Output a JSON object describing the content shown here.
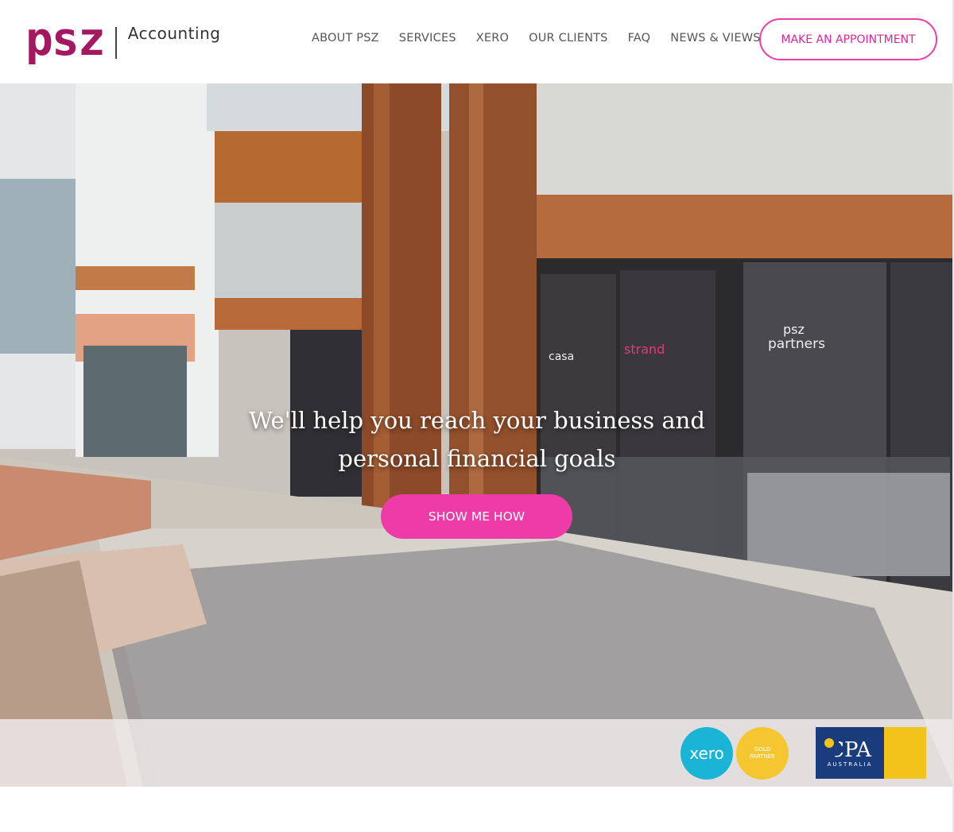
{
  "header": {
    "logo_text": "psz",
    "logo_sub": "Accounting",
    "nav": [
      {
        "label": "ABOUT PSZ"
      },
      {
        "label": "SERVICES"
      },
      {
        "label": "XERO"
      },
      {
        "label": "OUR CLIENTS"
      },
      {
        "label": "FAQ"
      },
      {
        "label": "NEWS & VIEWS"
      }
    ],
    "appointment_label": "MAKE AN APPOINTMENT"
  },
  "hero": {
    "headline_line1": "We'll help you reach your business and",
    "headline_line2": "personal financial goals",
    "cta_label": "SHOW ME HOW"
  },
  "badges": {
    "xero_label": "xero",
    "gold_partner_line1": "GOLD",
    "gold_partner_line2": "PARTNER",
    "cpa_main": "CPA",
    "cpa_sub": "AUSTRALIA"
  },
  "colors": {
    "brand": "#a3185f",
    "accent": "#ee3ba8",
    "xero": "#1ab4d7",
    "gold": "#f6c630",
    "cpa_blue": "#1a3b7c"
  }
}
